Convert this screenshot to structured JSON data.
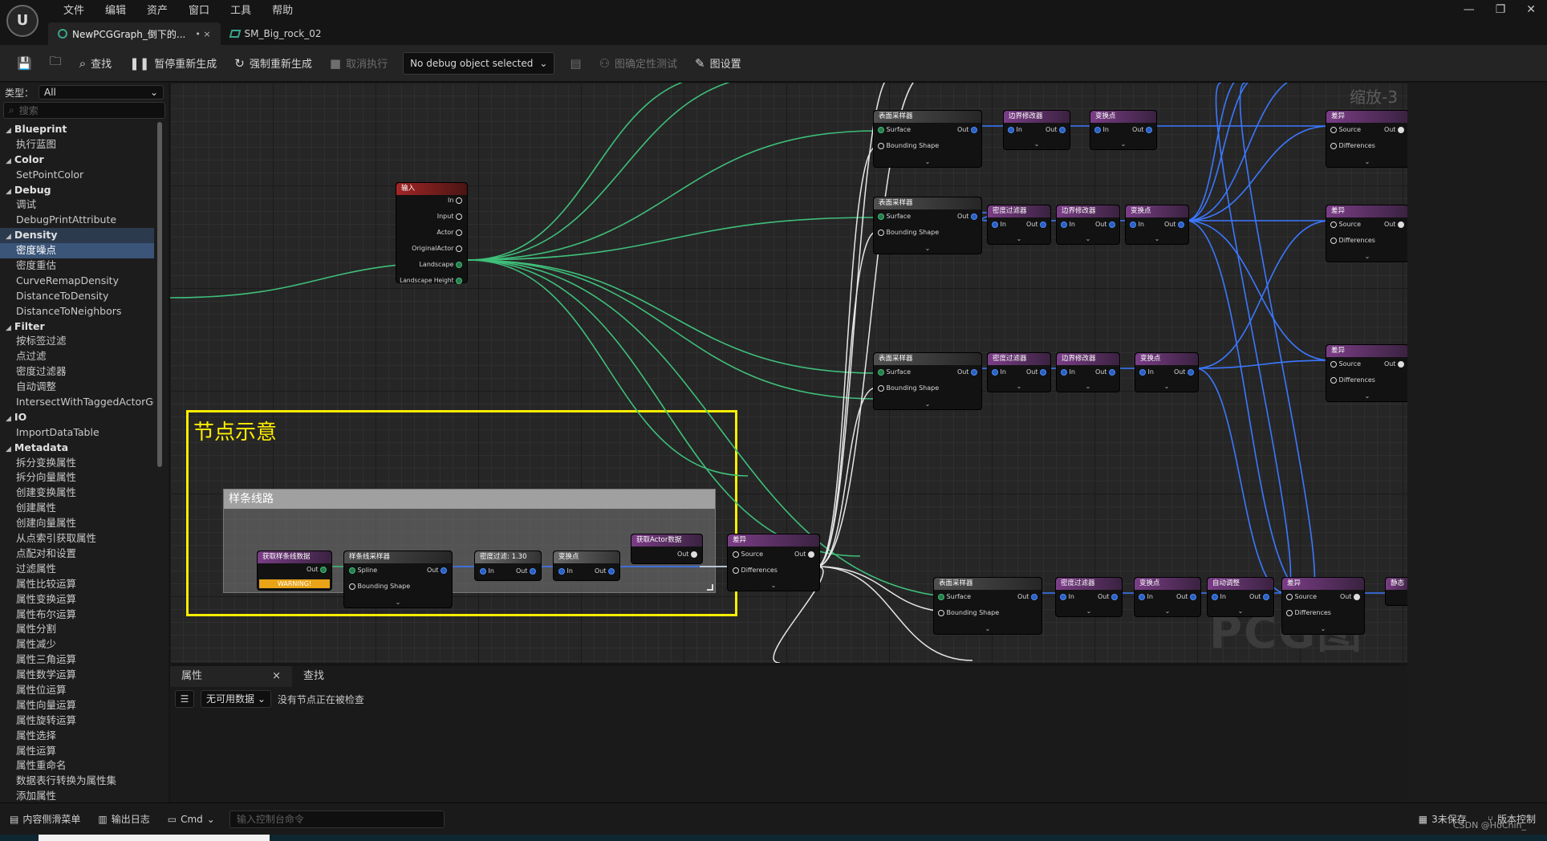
{
  "menu": [
    "文件",
    "编辑",
    "资产",
    "窗口",
    "工具",
    "帮助"
  ],
  "window_controls": [
    "—",
    "❐",
    "✕"
  ],
  "tabs": [
    {
      "label": "NewPCGGraph_倒下的...",
      "suffix": "• ×"
    },
    {
      "label": "SM_Big_rock_02"
    }
  ],
  "toolbar": {
    "find": "查找",
    "pause_regen": "暂停重新生成",
    "force_regen": "强制重新生成",
    "cancel_exec": "取消执行",
    "debug_object": "No debug object selected",
    "determinism_test": "图确定性测试",
    "graph_settings": "图设置"
  },
  "palette": {
    "type_label": "类型：",
    "type_value": "All",
    "search_placeholder": "搜索",
    "items": [
      {
        "t": "cat",
        "label": "Blueprint"
      },
      {
        "t": "item",
        "label": "执行蓝图"
      },
      {
        "t": "cat",
        "label": "Color"
      },
      {
        "t": "item",
        "label": "SetPointColor"
      },
      {
        "t": "cat",
        "label": "Debug"
      },
      {
        "t": "item",
        "label": "调试"
      },
      {
        "t": "item",
        "label": "DebugPrintAttribute"
      },
      {
        "t": "cat",
        "label": "Density",
        "hl": true
      },
      {
        "t": "item",
        "label": "密度噪点",
        "sel": true
      },
      {
        "t": "item",
        "label": "密度重估"
      },
      {
        "t": "item",
        "label": "CurveRemapDensity"
      },
      {
        "t": "item",
        "label": "DistanceToDensity"
      },
      {
        "t": "item",
        "label": "DistanceToNeighbors"
      },
      {
        "t": "cat",
        "label": "Filter"
      },
      {
        "t": "item",
        "label": "按标签过滤"
      },
      {
        "t": "item",
        "label": "点过滤"
      },
      {
        "t": "item",
        "label": "密度过滤器"
      },
      {
        "t": "item",
        "label": "自动调整"
      },
      {
        "t": "item",
        "label": "IntersectWithTaggedActorGec"
      },
      {
        "t": "cat",
        "label": "IO"
      },
      {
        "t": "item",
        "label": "ImportDataTable"
      },
      {
        "t": "cat",
        "label": "Metadata"
      },
      {
        "t": "item",
        "label": "拆分变换属性"
      },
      {
        "t": "item",
        "label": "拆分向量属性"
      },
      {
        "t": "item",
        "label": "创建变换属性"
      },
      {
        "t": "item",
        "label": "创建属性"
      },
      {
        "t": "item",
        "label": "创建向量属性"
      },
      {
        "t": "item",
        "label": "从点索引获取属性"
      },
      {
        "t": "item",
        "label": "点配对和设置"
      },
      {
        "t": "item",
        "label": "过滤属性"
      },
      {
        "t": "item",
        "label": "属性比较运算"
      },
      {
        "t": "item",
        "label": "属性变换运算"
      },
      {
        "t": "item",
        "label": "属性布尔运算"
      },
      {
        "t": "item",
        "label": "属性分割"
      },
      {
        "t": "item",
        "label": "属性减少"
      },
      {
        "t": "item",
        "label": "属性三角运算"
      },
      {
        "t": "item",
        "label": "属性数学运算"
      },
      {
        "t": "item",
        "label": "属性位运算"
      },
      {
        "t": "item",
        "label": "属性向量运算"
      },
      {
        "t": "item",
        "label": "属性旋转运算"
      },
      {
        "t": "item",
        "label": "属性选择"
      },
      {
        "t": "item",
        "label": "属性运算"
      },
      {
        "t": "item",
        "label": "属性重命名"
      },
      {
        "t": "item",
        "label": "数据表行转换为属性集"
      },
      {
        "t": "item",
        "label": "添加属性"
      }
    ]
  },
  "graph": {
    "zoom": "缩放-3",
    "watermark": "PCG图表",
    "comment_yellow": "节点示意",
    "comment_spline": "样条线路",
    "input_node": {
      "title": "输入",
      "pins": [
        "In",
        "Input",
        "Actor",
        "OriginalActor",
        "Landscape",
        "Landscape Height"
      ]
    },
    "spline_nodes": {
      "get_spline": "获取样条线数据",
      "warning": "WARNING!",
      "spline_sampler": "样条线采样器",
      "spline_pin": "Spline",
      "bounding": "Bounding Shape",
      "density_filter": "密度过滤: 1.30",
      "transform": "变换点",
      "get_actor": "获取Actor数据",
      "difference": "差异",
      "source": "Source",
      "differences": "Differences"
    },
    "row_nodes": {
      "surface_sampler": "表面采样器",
      "surface": "Surface",
      "bounds_modifier": "边界修改器",
      "transform_points": "变换点",
      "density_filter": "密度过滤器",
      "auto_adjust": "自动调整",
      "difference": "差异",
      "static": "静态",
      "in": "In",
      "out": "Out"
    }
  },
  "details": {
    "tab_props": "属性",
    "tab_close": "×",
    "tab_find": "查找",
    "filter_value": "无可用数据",
    "empty_msg": "没有节点正在被检查"
  },
  "statusbar": {
    "content_drawer": "内容侧滑菜单",
    "output_log": "输出日志",
    "cmd": "Cmd",
    "cmd_placeholder": "输入控制台命令",
    "unsaved": "3未保存",
    "source_control": "版本控制"
  },
  "watermark_csdn": "CSDN @HoChin_"
}
